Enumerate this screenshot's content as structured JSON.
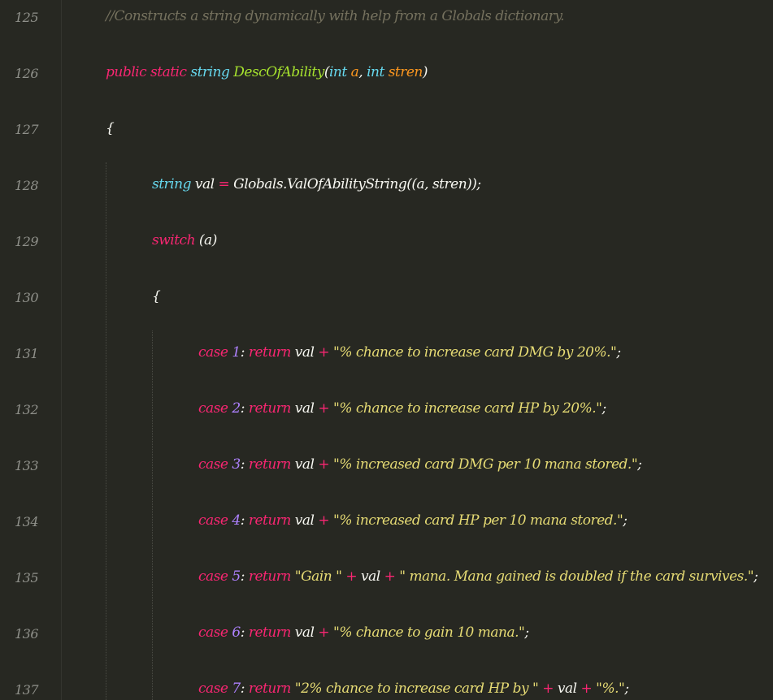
{
  "editor": {
    "lines": [
      {
        "number": "125",
        "tokens": [
          {
            "t": "//Constructs a string dynamically with help from a Globals dictionary.",
            "c": "cm"
          }
        ]
      },
      {
        "number": "126",
        "tokens": [
          {
            "t": "public static ",
            "c": "kw"
          },
          {
            "t": "string ",
            "c": "ty"
          },
          {
            "t": "DescOfAbility",
            "c": "fn"
          },
          {
            "t": "(",
            "c": "pl"
          },
          {
            "t": "int ",
            "c": "ty"
          },
          {
            "t": "a",
            "c": "pa"
          },
          {
            "t": ", ",
            "c": "pl"
          },
          {
            "t": "int ",
            "c": "ty"
          },
          {
            "t": "stren",
            "c": "pa"
          },
          {
            "t": ")",
            "c": "pl"
          }
        ]
      },
      {
        "number": "127",
        "tokens": [
          {
            "t": "{",
            "c": "pl"
          }
        ]
      },
      {
        "number": "128",
        "tokens": [
          {
            "t": "string ",
            "c": "ty"
          },
          {
            "t": "val ",
            "c": "pl"
          },
          {
            "t": "= ",
            "c": "kw"
          },
          {
            "t": "Globals.ValOfAbilityString((a, stren));",
            "c": "pl"
          }
        ]
      },
      {
        "number": "129",
        "tokens": [
          {
            "t": "switch ",
            "c": "kw"
          },
          {
            "t": "(a)",
            "c": "pl"
          }
        ]
      },
      {
        "number": "130",
        "tokens": [
          {
            "t": "{",
            "c": "pl"
          }
        ]
      },
      {
        "number": "131",
        "tokens": [
          {
            "t": "case ",
            "c": "kw"
          },
          {
            "t": "1",
            "c": "nu"
          },
          {
            "t": ": ",
            "c": "pl"
          },
          {
            "t": "return ",
            "c": "kw"
          },
          {
            "t": "val ",
            "c": "pl"
          },
          {
            "t": "+ ",
            "c": "kw"
          },
          {
            "t": "\"% chance to increase card DMG by 20%.\"",
            "c": "st"
          },
          {
            "t": ";",
            "c": "pl"
          }
        ]
      },
      {
        "number": "132",
        "tokens": [
          {
            "t": "case ",
            "c": "kw"
          },
          {
            "t": "2",
            "c": "nu"
          },
          {
            "t": ": ",
            "c": "pl"
          },
          {
            "t": "return ",
            "c": "kw"
          },
          {
            "t": "val ",
            "c": "pl"
          },
          {
            "t": "+ ",
            "c": "kw"
          },
          {
            "t": "\"% chance to increase card HP by 20%.\"",
            "c": "st"
          },
          {
            "t": ";",
            "c": "pl"
          }
        ]
      },
      {
        "number": "133",
        "tokens": [
          {
            "t": "case ",
            "c": "kw"
          },
          {
            "t": "3",
            "c": "nu"
          },
          {
            "t": ": ",
            "c": "pl"
          },
          {
            "t": "return ",
            "c": "kw"
          },
          {
            "t": "val ",
            "c": "pl"
          },
          {
            "t": "+ ",
            "c": "kw"
          },
          {
            "t": "\"% increased card DMG per 10 mana stored.\"",
            "c": "st"
          },
          {
            "t": ";",
            "c": "pl"
          }
        ]
      },
      {
        "number": "134",
        "tokens": [
          {
            "t": "case ",
            "c": "kw"
          },
          {
            "t": "4",
            "c": "nu"
          },
          {
            "t": ": ",
            "c": "pl"
          },
          {
            "t": "return ",
            "c": "kw"
          },
          {
            "t": "val ",
            "c": "pl"
          },
          {
            "t": "+ ",
            "c": "kw"
          },
          {
            "t": "\"% increased card HP per 10 mana stored.\"",
            "c": "st"
          },
          {
            "t": ";",
            "c": "pl"
          }
        ]
      },
      {
        "number": "135",
        "tokens": [
          {
            "t": "case ",
            "c": "kw"
          },
          {
            "t": "5",
            "c": "nu"
          },
          {
            "t": ": ",
            "c": "pl"
          },
          {
            "t": "return ",
            "c": "kw"
          },
          {
            "t": "\"Gain \" ",
            "c": "st"
          },
          {
            "t": "+ ",
            "c": "kw"
          },
          {
            "t": "val ",
            "c": "pl"
          },
          {
            "t": "+ ",
            "c": "kw"
          },
          {
            "t": "\" mana. Mana gained is doubled if the card survives.\"",
            "c": "st"
          },
          {
            "t": ";",
            "c": "pl"
          }
        ]
      },
      {
        "number": "136",
        "tokens": [
          {
            "t": "case ",
            "c": "kw"
          },
          {
            "t": "6",
            "c": "nu"
          },
          {
            "t": ": ",
            "c": "pl"
          },
          {
            "t": "return ",
            "c": "kw"
          },
          {
            "t": "val ",
            "c": "pl"
          },
          {
            "t": "+ ",
            "c": "kw"
          },
          {
            "t": "\"% chance to gain 10 mana.\"",
            "c": "st"
          },
          {
            "t": ";",
            "c": "pl"
          }
        ]
      },
      {
        "number": "137",
        "tokens": [
          {
            "t": "case ",
            "c": "kw"
          },
          {
            "t": "7",
            "c": "nu"
          },
          {
            "t": ": ",
            "c": "pl"
          },
          {
            "t": "return ",
            "c": "kw"
          },
          {
            "t": "\"2% chance to increase card HP by \" ",
            "c": "st"
          },
          {
            "t": "+ ",
            "c": "kw"
          },
          {
            "t": "val ",
            "c": "pl"
          },
          {
            "t": "+ ",
            "c": "kw"
          },
          {
            "t": "\"%.\"",
            "c": "st"
          },
          {
            "t": ";",
            "c": "pl"
          }
        ]
      }
    ]
  }
}
